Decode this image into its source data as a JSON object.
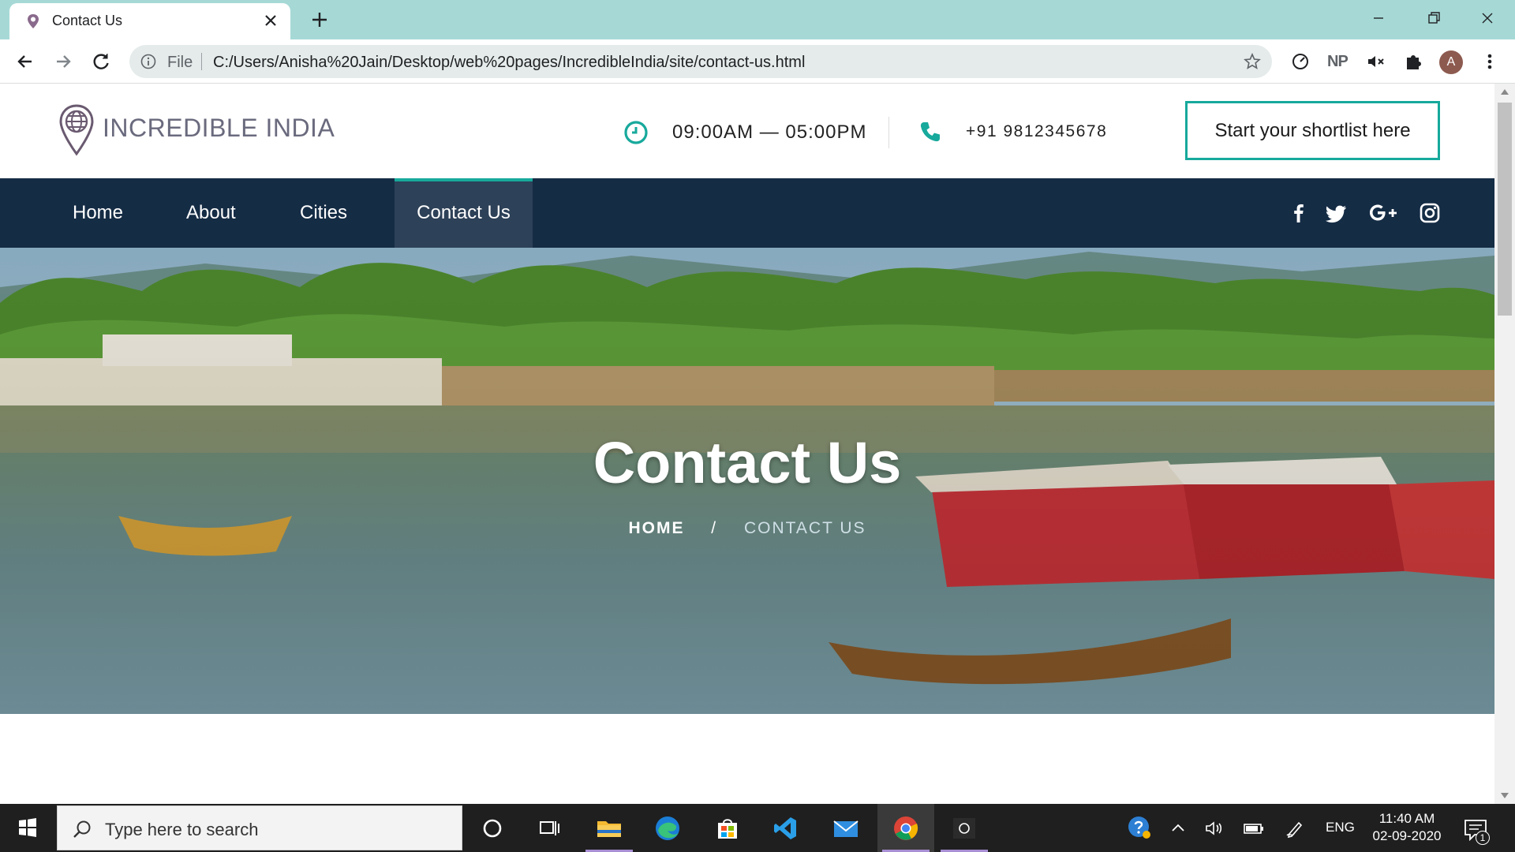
{
  "browser": {
    "tab_title": "Contact Us",
    "omnibox_scheme_label": "File",
    "url": "C:/Users/Anisha%20Jain/Desktop/web%20pages/IncredibleIndia/site/contact-us.html",
    "extension_np_label": "NP",
    "profile_initial": "A"
  },
  "site": {
    "logo_text": "INCREDIBLE INDIA",
    "hours": "09:00AM — 05:00PM",
    "phone": "+91 9812345678",
    "shortlist_label": "Start your shortlist here",
    "accent_color": "#17a99c",
    "nav_background": "#152c45",
    "nav": [
      {
        "label": "Home"
      },
      {
        "label": "About"
      },
      {
        "label": "Cities"
      },
      {
        "label": "Contact Us",
        "active": true
      }
    ],
    "social_icons": [
      "facebook-icon",
      "twitter-icon",
      "google-plus-icon",
      "instagram-icon"
    ]
  },
  "hero": {
    "title": "Contact Us",
    "breadcrumb_home": "HOME",
    "breadcrumb_separator": "/",
    "breadcrumb_current": "CONTACT US"
  },
  "taskbar": {
    "search_placeholder": "Type here to search",
    "language": "ENG",
    "time": "11:40 AM",
    "date": "02-09-2020",
    "notification_count": "1"
  }
}
